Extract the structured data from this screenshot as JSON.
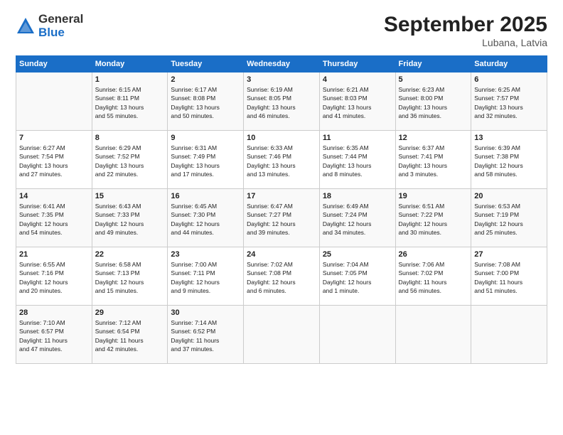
{
  "logo": {
    "general": "General",
    "blue": "Blue"
  },
  "title": "September 2025",
  "subtitle": "Lubana, Latvia",
  "headers": [
    "Sunday",
    "Monday",
    "Tuesday",
    "Wednesday",
    "Thursday",
    "Friday",
    "Saturday"
  ],
  "weeks": [
    [
      {
        "day": "",
        "info": ""
      },
      {
        "day": "1",
        "info": "Sunrise: 6:15 AM\nSunset: 8:11 PM\nDaylight: 13 hours\nand 55 minutes."
      },
      {
        "day": "2",
        "info": "Sunrise: 6:17 AM\nSunset: 8:08 PM\nDaylight: 13 hours\nand 50 minutes."
      },
      {
        "day": "3",
        "info": "Sunrise: 6:19 AM\nSunset: 8:05 PM\nDaylight: 13 hours\nand 46 minutes."
      },
      {
        "day": "4",
        "info": "Sunrise: 6:21 AM\nSunset: 8:03 PM\nDaylight: 13 hours\nand 41 minutes."
      },
      {
        "day": "5",
        "info": "Sunrise: 6:23 AM\nSunset: 8:00 PM\nDaylight: 13 hours\nand 36 minutes."
      },
      {
        "day": "6",
        "info": "Sunrise: 6:25 AM\nSunset: 7:57 PM\nDaylight: 13 hours\nand 32 minutes."
      }
    ],
    [
      {
        "day": "7",
        "info": "Sunrise: 6:27 AM\nSunset: 7:54 PM\nDaylight: 13 hours\nand 27 minutes."
      },
      {
        "day": "8",
        "info": "Sunrise: 6:29 AM\nSunset: 7:52 PM\nDaylight: 13 hours\nand 22 minutes."
      },
      {
        "day": "9",
        "info": "Sunrise: 6:31 AM\nSunset: 7:49 PM\nDaylight: 13 hours\nand 17 minutes."
      },
      {
        "day": "10",
        "info": "Sunrise: 6:33 AM\nSunset: 7:46 PM\nDaylight: 13 hours\nand 13 minutes."
      },
      {
        "day": "11",
        "info": "Sunrise: 6:35 AM\nSunset: 7:44 PM\nDaylight: 13 hours\nand 8 minutes."
      },
      {
        "day": "12",
        "info": "Sunrise: 6:37 AM\nSunset: 7:41 PM\nDaylight: 13 hours\nand 3 minutes."
      },
      {
        "day": "13",
        "info": "Sunrise: 6:39 AM\nSunset: 7:38 PM\nDaylight: 12 hours\nand 58 minutes."
      }
    ],
    [
      {
        "day": "14",
        "info": "Sunrise: 6:41 AM\nSunset: 7:35 PM\nDaylight: 12 hours\nand 54 minutes."
      },
      {
        "day": "15",
        "info": "Sunrise: 6:43 AM\nSunset: 7:33 PM\nDaylight: 12 hours\nand 49 minutes."
      },
      {
        "day": "16",
        "info": "Sunrise: 6:45 AM\nSunset: 7:30 PM\nDaylight: 12 hours\nand 44 minutes."
      },
      {
        "day": "17",
        "info": "Sunrise: 6:47 AM\nSunset: 7:27 PM\nDaylight: 12 hours\nand 39 minutes."
      },
      {
        "day": "18",
        "info": "Sunrise: 6:49 AM\nSunset: 7:24 PM\nDaylight: 12 hours\nand 34 minutes."
      },
      {
        "day": "19",
        "info": "Sunrise: 6:51 AM\nSunset: 7:22 PM\nDaylight: 12 hours\nand 30 minutes."
      },
      {
        "day": "20",
        "info": "Sunrise: 6:53 AM\nSunset: 7:19 PM\nDaylight: 12 hours\nand 25 minutes."
      }
    ],
    [
      {
        "day": "21",
        "info": "Sunrise: 6:55 AM\nSunset: 7:16 PM\nDaylight: 12 hours\nand 20 minutes."
      },
      {
        "day": "22",
        "info": "Sunrise: 6:58 AM\nSunset: 7:13 PM\nDaylight: 12 hours\nand 15 minutes."
      },
      {
        "day": "23",
        "info": "Sunrise: 7:00 AM\nSunset: 7:11 PM\nDaylight: 12 hours\nand 9 minutes."
      },
      {
        "day": "24",
        "info": "Sunrise: 7:02 AM\nSunset: 7:08 PM\nDaylight: 12 hours\nand 6 minutes."
      },
      {
        "day": "25",
        "info": "Sunrise: 7:04 AM\nSunset: 7:05 PM\nDaylight: 12 hours\nand 1 minute."
      },
      {
        "day": "26",
        "info": "Sunrise: 7:06 AM\nSunset: 7:02 PM\nDaylight: 11 hours\nand 56 minutes."
      },
      {
        "day": "27",
        "info": "Sunrise: 7:08 AM\nSunset: 7:00 PM\nDaylight: 11 hours\nand 51 minutes."
      }
    ],
    [
      {
        "day": "28",
        "info": "Sunrise: 7:10 AM\nSunset: 6:57 PM\nDaylight: 11 hours\nand 47 minutes."
      },
      {
        "day": "29",
        "info": "Sunrise: 7:12 AM\nSunset: 6:54 PM\nDaylight: 11 hours\nand 42 minutes."
      },
      {
        "day": "30",
        "info": "Sunrise: 7:14 AM\nSunset: 6:52 PM\nDaylight: 11 hours\nand 37 minutes."
      },
      {
        "day": "",
        "info": ""
      },
      {
        "day": "",
        "info": ""
      },
      {
        "day": "",
        "info": ""
      },
      {
        "day": "",
        "info": ""
      }
    ]
  ]
}
